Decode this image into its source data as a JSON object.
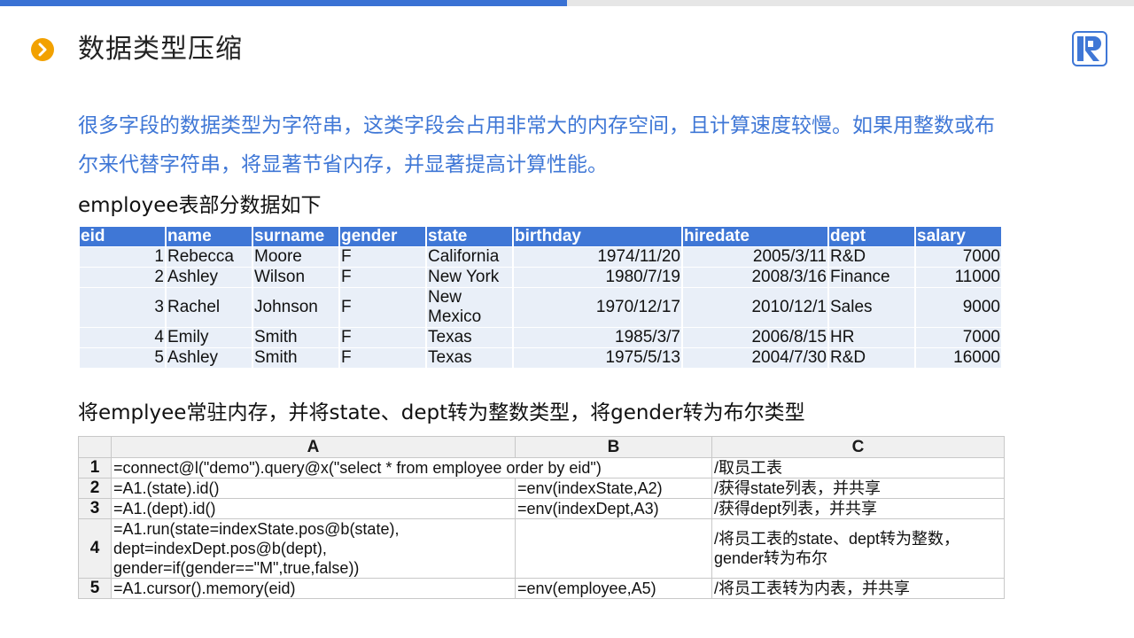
{
  "progress": 0.5,
  "title": "数据类型压缩",
  "intro": {
    "line1": "很多字段的数据类型为字符串，这类字段会占用非常大的内存空间，且计算速度较慢。如果用整数或布",
    "line2": "尔来代替字符串，将显著节省内存，并显著提高计算性能。"
  },
  "employee_heading": "employee表部分数据如下",
  "employee": {
    "columns": [
      "eid",
      "name",
      "surname",
      "gender",
      "state",
      "birthday",
      "hiredate",
      "dept",
      "salary"
    ],
    "rows": [
      [
        "1",
        "Rebecca",
        "Moore",
        "F",
        "California",
        "1974/11/20",
        "2005/3/11",
        "R&D",
        "7000"
      ],
      [
        "2",
        "Ashley",
        "Wilson",
        "F",
        "New York",
        "1980/7/19",
        "2008/3/16",
        "Finance",
        "11000"
      ],
      [
        "3",
        "Rachel",
        "Johnson",
        "F",
        "New Mexico",
        "1970/12/17",
        "2010/12/1",
        "Sales",
        "9000"
      ],
      [
        "4",
        "Emily",
        "Smith",
        "F",
        "Texas",
        "1985/3/7",
        "2006/8/15",
        "HR",
        "7000"
      ],
      [
        "5",
        "Ashley",
        "Smith",
        "F",
        "Texas",
        "1975/5/13",
        "2004/7/30",
        "R&D",
        "16000"
      ]
    ]
  },
  "grid_heading": "将emplyee常驻内存，并将state、dept转为整数类型，将gender转为布尔类型",
  "grid": {
    "columns": [
      "A",
      "B",
      "C"
    ],
    "rows": [
      {
        "n": "1",
        "a": [
          "=connect@l(\"demo\").query@x(\"select * from employee order by eid\")"
        ],
        "b": "",
        "c": [
          "/取员工表"
        ]
      },
      {
        "n": "2",
        "a": [
          "=A1.(state).id()"
        ],
        "b": "=env(indexState,A2)",
        "c": [
          "/获得state列表，并共享"
        ]
      },
      {
        "n": "3",
        "a": [
          "=A1.(dept).id()"
        ],
        "b": "=env(indexDept,A3)",
        "c": [
          "/获得dept列表，并共享"
        ]
      },
      {
        "n": "4",
        "a": [
          "=A1.run(state=indexState.pos@b(state),",
          "dept=indexDept.pos@b(dept),",
          "gender=if(gender==\"M\",true,false))"
        ],
        "b": "",
        "c": [
          "/将员工表的state、dept转为整数，",
          "gender转为布尔"
        ]
      },
      {
        "n": "5",
        "a": [
          "=A1.cursor().memory(eid)"
        ],
        "b": "=env(employee,A5)",
        "c": [
          "/将员工表转为内表，并共享"
        ]
      }
    ]
  },
  "colors": {
    "accent": "#3f77d6",
    "icon": "#f2a100",
    "row_bg": "#e9eff8"
  },
  "icons": {
    "title": "chevron-right-icon",
    "logo": "raqsoft-logo-icon"
  }
}
